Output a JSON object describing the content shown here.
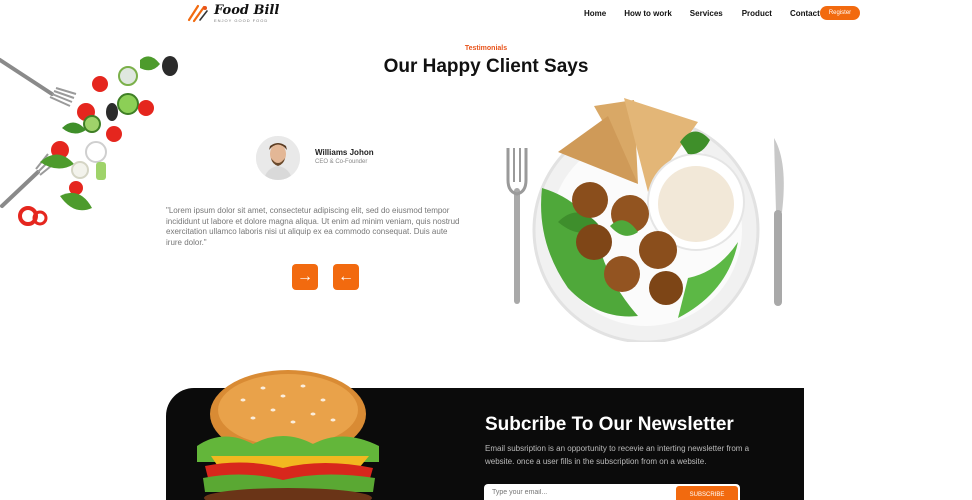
{
  "brand": {
    "name": "Food Bill",
    "tagline": "ENJOY GOOD FOOD",
    "accent": "#f26a0f"
  },
  "nav": {
    "items": [
      "Home",
      "How to work",
      "Services",
      "Product",
      "Contact"
    ],
    "register_label": "Register"
  },
  "testimonials": {
    "tag": "Testimonials",
    "title": "Our Happy Client Says",
    "client_name": "Williams Johon",
    "client_role": "CEO & Co-Founder",
    "quote": "\"Lorem ipsum dolor sit amet, consectetur adipiscing elit, sed do eiusmod tempor incididunt ut labore et dolore magna aliqua. Ut enim ad minim veniam, quis nostrud exercitation ullamco laboris nisi ut aliquip ex ea commodo consequat. Duis aute irure dolor.\"",
    "next_icon": "arrow-right-icon",
    "prev_icon": "arrow-left-icon"
  },
  "newsletter": {
    "title": "Subcribe To Our Newsletter",
    "text": "Email subsription is an opportunity to recevie an interting newsletter from a website. once a user fills in the subscription from on a website.",
    "placeholder": "Type your email...",
    "submit_label": "SUBSCRIBE"
  }
}
